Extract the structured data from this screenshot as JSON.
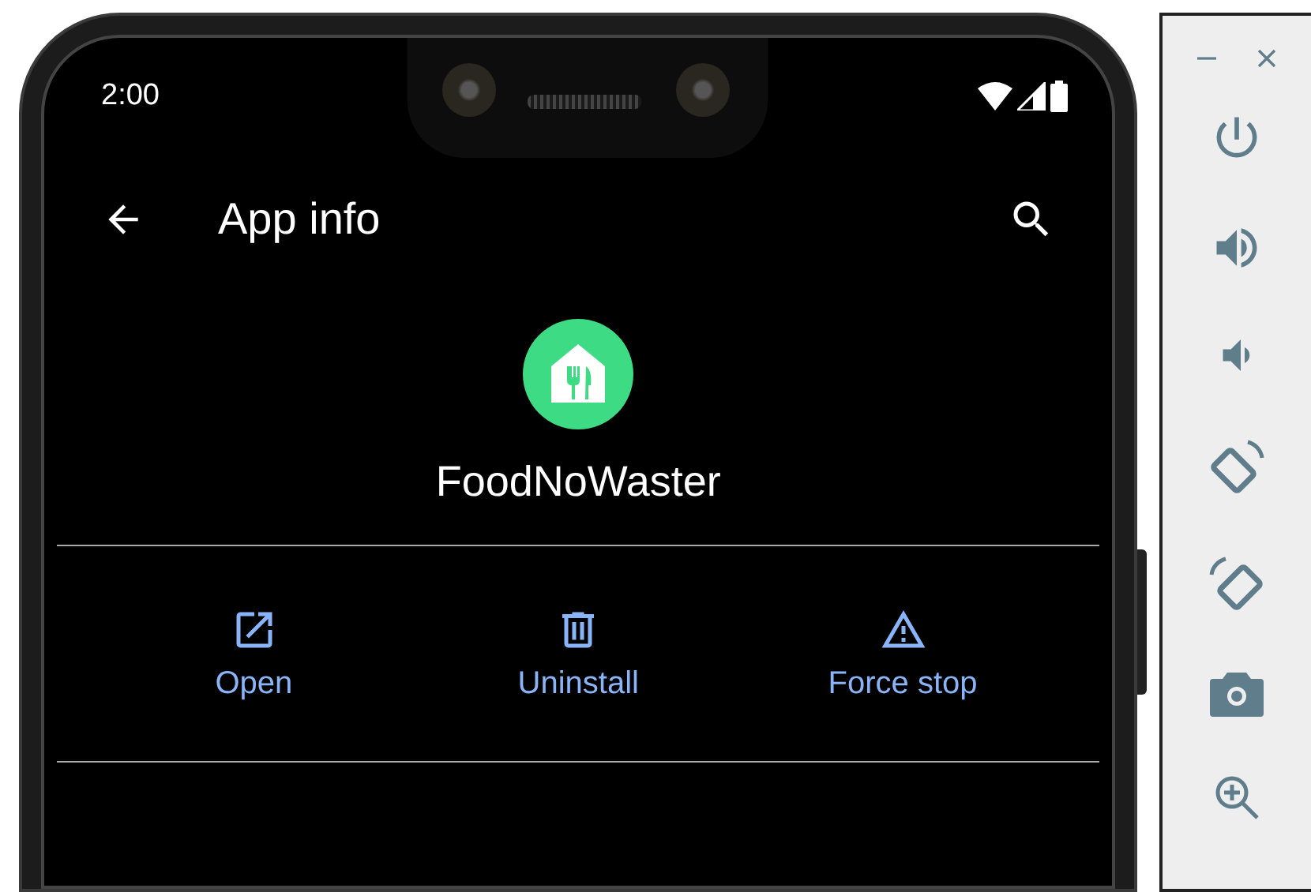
{
  "status_bar": {
    "time": "2:00"
  },
  "app_bar": {
    "title": "App info"
  },
  "app": {
    "name": "FoodNoWaster"
  },
  "actions": [
    {
      "kind": "open",
      "label": "Open"
    },
    {
      "kind": "uninstall",
      "label": "Uninstall"
    },
    {
      "kind": "force_stop",
      "label": "Force stop"
    }
  ]
}
